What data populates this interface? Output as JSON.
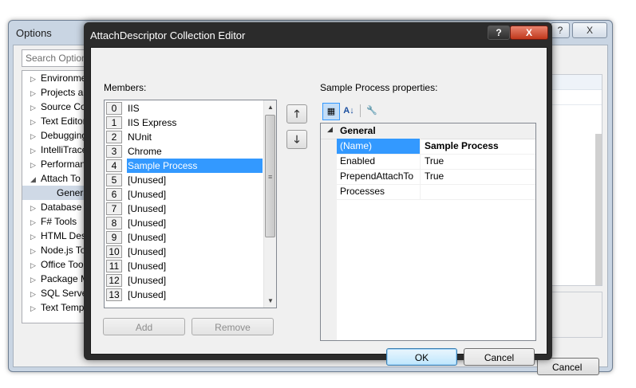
{
  "options_window": {
    "title": "Options",
    "help_glyph": "?",
    "close_glyph": "X",
    "search_placeholder": "Search Options",
    "tree": [
      {
        "label": "Environment",
        "expander": "▷"
      },
      {
        "label": "Projects and Solutions",
        "expander": "▷"
      },
      {
        "label": "Source Control",
        "expander": "▷"
      },
      {
        "label": "Text Editor",
        "expander": "▷"
      },
      {
        "label": "Debugging",
        "expander": "▷"
      },
      {
        "label": "IntelliTrace",
        "expander": "▷"
      },
      {
        "label": "Performance Tools",
        "expander": "▷"
      },
      {
        "label": "Attach To",
        "expander": "◢"
      },
      {
        "label": "General",
        "expander": ""
      },
      {
        "label": "Database Tools",
        "expander": "▷"
      },
      {
        "label": "F# Tools",
        "expander": "▷"
      },
      {
        "label": "HTML Designer",
        "expander": "▷"
      },
      {
        "label": "Node.js Tools",
        "expander": "▷"
      },
      {
        "label": "Office Tools",
        "expander": "▷"
      },
      {
        "label": "Package Manager",
        "expander": "▷"
      },
      {
        "label": "SQL Server Tools",
        "expander": "▷"
      },
      {
        "label": "Text Templating",
        "expander": "▷"
      }
    ],
    "cancel_label": "Cancel"
  },
  "dialog": {
    "title": "AttachDescriptor Collection Editor",
    "help_glyph": "?",
    "close_glyph": "X",
    "members_label": "Members:",
    "members": [
      {
        "index": "0",
        "name": "IIS"
      },
      {
        "index": "1",
        "name": "IIS Express"
      },
      {
        "index": "2",
        "name": "NUnit"
      },
      {
        "index": "3",
        "name": "Chrome"
      },
      {
        "index": "4",
        "name": "Sample Process"
      },
      {
        "index": "5",
        "name": "[Unused]"
      },
      {
        "index": "6",
        "name": "[Unused]"
      },
      {
        "index": "7",
        "name": "[Unused]"
      },
      {
        "index": "8",
        "name": "[Unused]"
      },
      {
        "index": "9",
        "name": "[Unused]"
      },
      {
        "index": "10",
        "name": "[Unused]"
      },
      {
        "index": "11",
        "name": "[Unused]"
      },
      {
        "index": "12",
        "name": "[Unused]"
      },
      {
        "index": "13",
        "name": "[Unused]"
      }
    ],
    "selected_member_index": 4,
    "move_up_glyph": "🡑",
    "move_down_glyph": "🡓",
    "add_label": "Add",
    "remove_label": "Remove",
    "properties_label": "Sample Process properties:",
    "toolbar": {
      "categorized_glyph": "▦",
      "alphabetical_glyph": "A↓",
      "property_pages_glyph": "🔧"
    },
    "category": "General",
    "properties": [
      {
        "name": "(Name)",
        "value": "Sample Process"
      },
      {
        "name": "Enabled",
        "value": "True"
      },
      {
        "name": "PrependAttachTo",
        "value": "True"
      },
      {
        "name": "Processes",
        "value": ""
      }
    ],
    "ok_label": "OK",
    "cancel_label": "Cancel"
  }
}
